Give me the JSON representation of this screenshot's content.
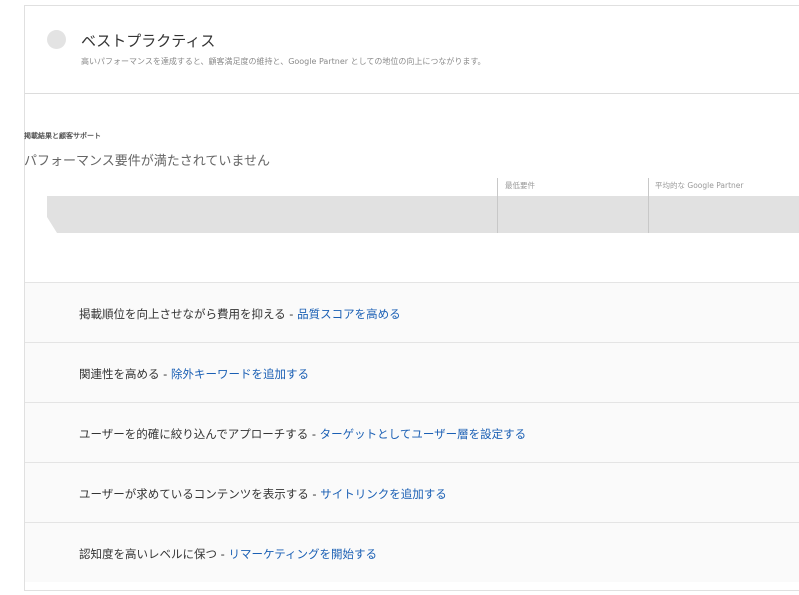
{
  "header": {
    "title": "ベストプラクティス",
    "subtitle": "高いパフォーマンスを達成すると、顧客満足度の維持と、Google Partner としての地位の向上につながります。"
  },
  "section": {
    "heading": "掲載結果と顧客サポート",
    "status": "パフォーマンス要件が満たされていません",
    "columns": [
      "最低要件",
      "平均的な Google Partner"
    ]
  },
  "recommendations": [
    {
      "text": "掲載順位を向上させながら費用を抑える",
      "separator": " - ",
      "link": "品質スコアを高める"
    },
    {
      "text": "関連性を高める",
      "separator": " - ",
      "link": "除外キーワードを追加する"
    },
    {
      "text": "ユーザーを的確に絞り込んでアプローチする",
      "separator": " - ",
      "link": "ターゲットとしてユーザー層を設定する"
    },
    {
      "text": "ユーザーが求めているコンテンツを表示する",
      "separator": " - ",
      "link": "サイトリンクを追加する"
    },
    {
      "text": "認知度を高いレベルに保つ",
      "separator": " - ",
      "link": "リマーケティングを開始する"
    }
  ],
  "colors": {
    "link": "#1a5fb4",
    "status_indicator": "#e3e3e3",
    "bar": "#e1e1e1"
  }
}
